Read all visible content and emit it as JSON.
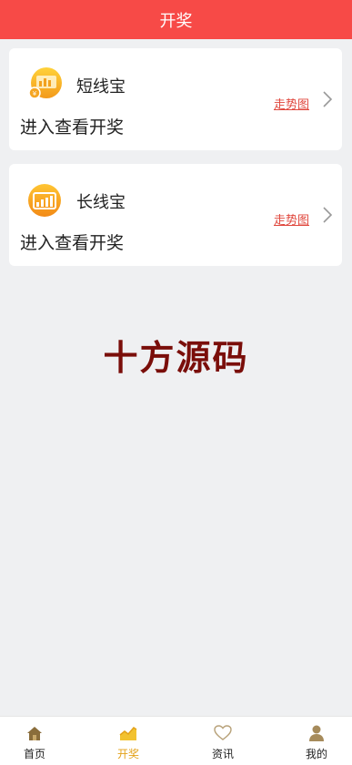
{
  "header": {
    "title": "开奖"
  },
  "cards": [
    {
      "name": "短线宝",
      "subtitle": "进入查看开奖",
      "trend_link": "走势图",
      "icon": "chart-coin-icon"
    },
    {
      "name": "长线宝",
      "subtitle": "进入查看开奖",
      "trend_link": "走势图",
      "icon": "bar-chart-icon"
    }
  ],
  "watermark": "十方源码",
  "tabbar": {
    "items": [
      {
        "label": "首页",
        "icon": "home-icon"
      },
      {
        "label": "开奖",
        "icon": "trend-icon",
        "active": true
      },
      {
        "label": "资讯",
        "icon": "heart-icon"
      },
      {
        "label": "我的",
        "icon": "user-icon"
      }
    ]
  },
  "colors": {
    "header_bg": "#f74a47",
    "accent": "#e3a21a",
    "link": "#e0473d",
    "watermark": "#7a0e0a",
    "background": "#eff0f2"
  }
}
